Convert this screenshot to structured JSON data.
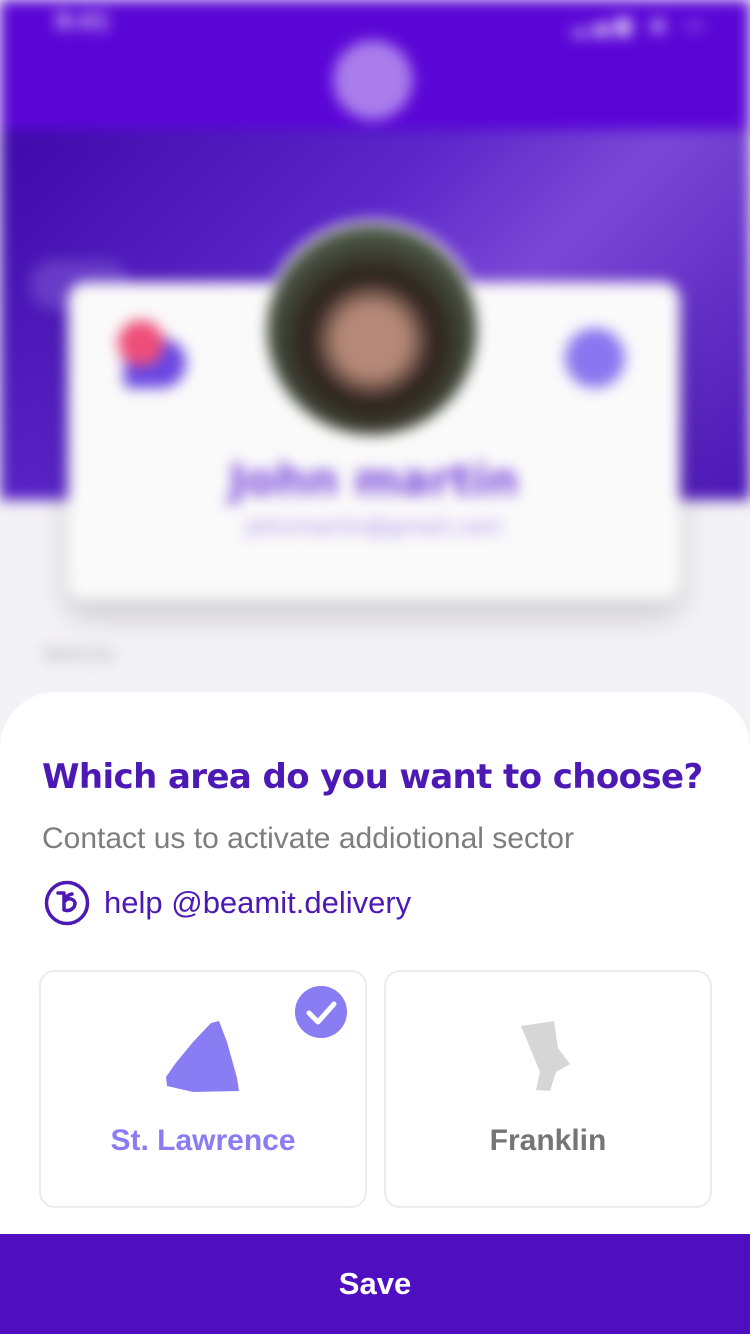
{
  "status_bar": {
    "time": "9:41"
  },
  "profile": {
    "name": "John martin",
    "email": "johnmartin@gmail.com",
    "field_label": "Vehicle"
  },
  "sheet": {
    "title": "Which area do you want to choose?",
    "subtitle": "Contact us to activate addiotional sector",
    "help_email": "help @beamit.delivery",
    "accent_color": "#4d19b5"
  },
  "areas": [
    {
      "name": "St. Lawrence",
      "selected": true,
      "color": "#8a7cf3",
      "icon": "area-polygon-icon"
    },
    {
      "name": "Franklin",
      "selected": false,
      "color": "#d6d6d6",
      "icon": "area-polygon-icon"
    }
  ],
  "save_button": {
    "label": "Save",
    "color": "#4f0ec0"
  }
}
